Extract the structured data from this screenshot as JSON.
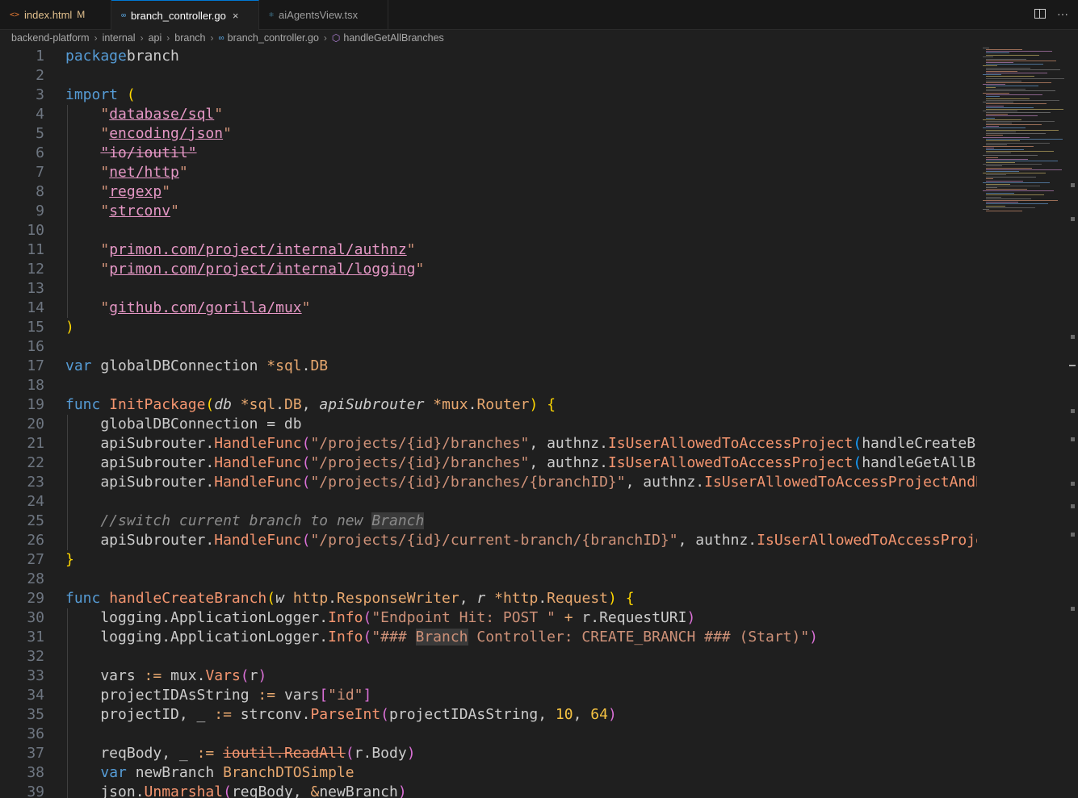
{
  "tabs": [
    {
      "name": "index.html",
      "modified": "M",
      "icon": "html-icon",
      "glyph": "<>"
    },
    {
      "name": "branch_controller.go",
      "icon": "go-icon",
      "glyph": "∞",
      "close": "×"
    },
    {
      "name": "aiAgentsView.tsx",
      "icon": "react-icon",
      "glyph": "⚛"
    }
  ],
  "breadcrumb": [
    "backend-platform",
    "internal",
    "api",
    "branch",
    "branch_controller.go",
    "handleGetAllBranches"
  ],
  "line_numbers": [
    "1",
    "2",
    "3",
    "4",
    "5",
    "6",
    "7",
    "8",
    "9",
    "10",
    "11",
    "12",
    "13",
    "14",
    "15",
    "16",
    "17",
    "18",
    "19",
    "20",
    "21",
    "22",
    "23",
    "24",
    "25",
    "26",
    "27",
    "28",
    "29",
    "30",
    "31",
    "32",
    "33",
    "34",
    "35",
    "36",
    "37",
    "38",
    "39"
  ],
  "code": [
    [
      [
        "k",
        "package"
      ],
      [
        "",
        "branch"
      ]
    ],
    [],
    [
      [
        "k",
        "import"
      ],
      [
        "",
        ""
      ],
      [
        "b1",
        "("
      ]
    ],
    [
      [
        "",
        "    "
      ],
      [
        "s",
        "\""
      ],
      [
        "su",
        "database/sql"
      ],
      [
        "s",
        "\""
      ]
    ],
    [
      [
        "",
        "    "
      ],
      [
        "s",
        "\""
      ],
      [
        "su",
        "encoding/json"
      ],
      [
        "s",
        "\""
      ]
    ],
    [
      [
        "",
        "    "
      ],
      [
        "sd",
        "\"io/ioutil\""
      ]
    ],
    [
      [
        "",
        "    "
      ],
      [
        "s",
        "\""
      ],
      [
        "su",
        "net/http"
      ],
      [
        "s",
        "\""
      ]
    ],
    [
      [
        "",
        "    "
      ],
      [
        "s",
        "\""
      ],
      [
        "su",
        "regexp"
      ],
      [
        "s",
        "\""
      ]
    ],
    [
      [
        "",
        "    "
      ],
      [
        "s",
        "\""
      ],
      [
        "su",
        "strconv"
      ],
      [
        "s",
        "\""
      ]
    ],
    [],
    [
      [
        "",
        "    "
      ],
      [
        "s",
        "\""
      ],
      [
        "su",
        "primon.com/project/internal/authnz"
      ],
      [
        "s",
        "\""
      ]
    ],
    [
      [
        "",
        "    "
      ],
      [
        "s",
        "\""
      ],
      [
        "su",
        "primon.com/project/internal/logging"
      ],
      [
        "s",
        "\""
      ]
    ],
    [],
    [
      [
        "",
        "    "
      ],
      [
        "s",
        "\""
      ],
      [
        "su",
        "github.com/gorilla/mux"
      ],
      [
        "s",
        "\""
      ]
    ],
    [
      [
        "b1",
        ")"
      ]
    ],
    [],
    [
      [
        "k",
        "var"
      ],
      [
        "",
        ""
      ],
      [
        "",
        "globalDBConnection "
      ],
      [
        "op",
        "*"
      ],
      [
        "t",
        "sql"
      ],
      [
        "",
        ""
      ],
      [
        "t",
        "DB"
      ]
    ],
    [],
    [
      [
        "k",
        "func"
      ],
      [
        "",
        ""
      ],
      [
        "f",
        "InitPackage"
      ],
      [
        "b1",
        "("
      ],
      [
        "p",
        "db"
      ],
      [
        "",
        ""
      ],
      [
        "op",
        "*"
      ],
      [
        "t",
        "sql"
      ],
      [
        "",
        ""
      ],
      [
        "t",
        "DB"
      ],
      [
        "",
        ", "
      ],
      [
        "p",
        "apiSubrouter"
      ],
      [
        "",
        ""
      ],
      [
        "op",
        "*"
      ],
      [
        "t",
        "mux"
      ],
      [
        "",
        ""
      ],
      [
        "t",
        "Router"
      ],
      [
        "b1",
        ")"
      ],
      [
        "",
        ""
      ],
      [
        "b1",
        "{"
      ]
    ],
    [
      [
        "",
        "    globalDBConnection = db"
      ]
    ],
    [
      [
        "",
        "    apiSubrouter."
      ],
      [
        "f",
        "HandleFunc"
      ],
      [
        "b2",
        "("
      ],
      [
        "s",
        "\"/projects/{id}/branches\""
      ],
      [
        "",
        ", authnz."
      ],
      [
        "f",
        "IsUserAllowedToAccessProject"
      ],
      [
        "b3",
        "("
      ],
      [
        "",
        "handleCreateBranch"
      ]
    ],
    [
      [
        "",
        "    apiSubrouter."
      ],
      [
        "f",
        "HandleFunc"
      ],
      [
        "b2",
        "("
      ],
      [
        "s",
        "\"/projects/{id}/branches\""
      ],
      [
        "",
        ", authnz."
      ],
      [
        "f",
        "IsUserAllowedToAccessProject"
      ],
      [
        "b3",
        "("
      ],
      [
        "",
        "handleGetAllBranches"
      ]
    ],
    [
      [
        "",
        "    apiSubrouter."
      ],
      [
        "f",
        "HandleFunc"
      ],
      [
        "b2",
        "("
      ],
      [
        "s",
        "\"/projects/{id}/branches/{branchID}\""
      ],
      [
        "",
        ", authnz."
      ],
      [
        "f",
        "IsUserAllowedToAccessProjectAndBranch"
      ]
    ],
    [],
    [
      [
        "",
        "    "
      ],
      [
        "c",
        "//switch current branch to new "
      ],
      [
        "ch",
        "Branch"
      ]
    ],
    [
      [
        "",
        "    apiSubrouter."
      ],
      [
        "f",
        "HandleFunc"
      ],
      [
        "b2",
        "("
      ],
      [
        "s",
        "\"/projects/{id}/current-branch/{branchID}\""
      ],
      [
        "",
        ", authnz."
      ],
      [
        "f",
        "IsUserAllowedToAccessProject"
      ]
    ],
    [
      [
        "b1",
        "}"
      ]
    ],
    [],
    [
      [
        "k",
        "func"
      ],
      [
        "",
        ""
      ],
      [
        "f",
        "handleCreateBranch"
      ],
      [
        "b1",
        "("
      ],
      [
        "p",
        "w"
      ],
      [
        "",
        ""
      ],
      [
        "t",
        "http"
      ],
      [
        "",
        ""
      ],
      [
        "t",
        "ResponseWriter"
      ],
      [
        "",
        ", "
      ],
      [
        "p",
        "r"
      ],
      [
        "",
        ""
      ],
      [
        "op",
        "*"
      ],
      [
        "t",
        "http"
      ],
      [
        "",
        ""
      ],
      [
        "t",
        "Request"
      ],
      [
        "b1",
        ")"
      ],
      [
        "",
        ""
      ],
      [
        "b1",
        "{"
      ]
    ],
    [
      [
        "",
        "    logging.ApplicationLogger."
      ],
      [
        "f",
        "Info"
      ],
      [
        "b2",
        "("
      ],
      [
        "s",
        "\"Endpoint Hit: POST \""
      ],
      [
        "",
        ""
      ],
      [
        "op",
        "+"
      ],
      [
        "",
        ""
      ],
      [
        "",
        "r.RequestURI"
      ],
      [
        "b2",
        ")"
      ]
    ],
    [
      [
        "",
        "    logging.ApplicationLogger."
      ],
      [
        "f",
        "Info"
      ],
      [
        "b2",
        "("
      ],
      [
        "s",
        "\"### "
      ],
      [
        "sh",
        "Branch"
      ],
      [
        "s",
        " Controller: CREATE_BRANCH ### (Start)\""
      ],
      [
        "b2",
        ")"
      ]
    ],
    [],
    [
      [
        "",
        "    vars "
      ],
      [
        "op",
        ":="
      ],
      [
        "",
        ""
      ],
      [
        "",
        "mux."
      ],
      [
        "f",
        "Vars"
      ],
      [
        "b2",
        "("
      ],
      [
        "",
        "r"
      ],
      [
        "b2",
        ")"
      ]
    ],
    [
      [
        "",
        "    projectIDAsString "
      ],
      [
        "op",
        ":="
      ],
      [
        "",
        ""
      ],
      [
        "",
        "vars"
      ],
      [
        "b2",
        "["
      ],
      [
        "s",
        "\"id\""
      ],
      [
        "b2",
        "]"
      ]
    ],
    [
      [
        "",
        "    projectID, _ "
      ],
      [
        "op",
        ":="
      ],
      [
        "",
        ""
      ],
      [
        "",
        "strconv."
      ],
      [
        "f",
        "ParseInt"
      ],
      [
        "b2",
        "("
      ],
      [
        "",
        "projectIDAsString, "
      ],
      [
        "n",
        "10"
      ],
      [
        "",
        ", "
      ],
      [
        "n",
        "64"
      ],
      [
        "b2",
        ")"
      ]
    ],
    [],
    [
      [
        "",
        "    reqBody, _ "
      ],
      [
        "op",
        ":="
      ],
      [
        "",
        ""
      ],
      [
        "fd",
        "ioutil.ReadAll"
      ],
      [
        "b2",
        "("
      ],
      [
        "",
        "r.Body"
      ],
      [
        "b2",
        ")"
      ]
    ],
    [
      [
        "",
        "    "
      ],
      [
        "k",
        "var"
      ],
      [
        "",
        ""
      ],
      [
        "",
        "newBranch "
      ],
      [
        "t",
        "BranchDTOSimple"
      ]
    ],
    [
      [
        "",
        "    json."
      ],
      [
        "f",
        "Unmarshal"
      ],
      [
        "b2",
        "("
      ],
      [
        "",
        "reqBody, "
      ],
      [
        "op",
        "&"
      ],
      [
        "",
        "newBranch"
      ],
      [
        "b2",
        ")"
      ]
    ]
  ],
  "colors": {
    "accent": "#0078d4",
    "keyword": "#569cd6",
    "string": "#ce9178",
    "function": "#f4956f"
  }
}
